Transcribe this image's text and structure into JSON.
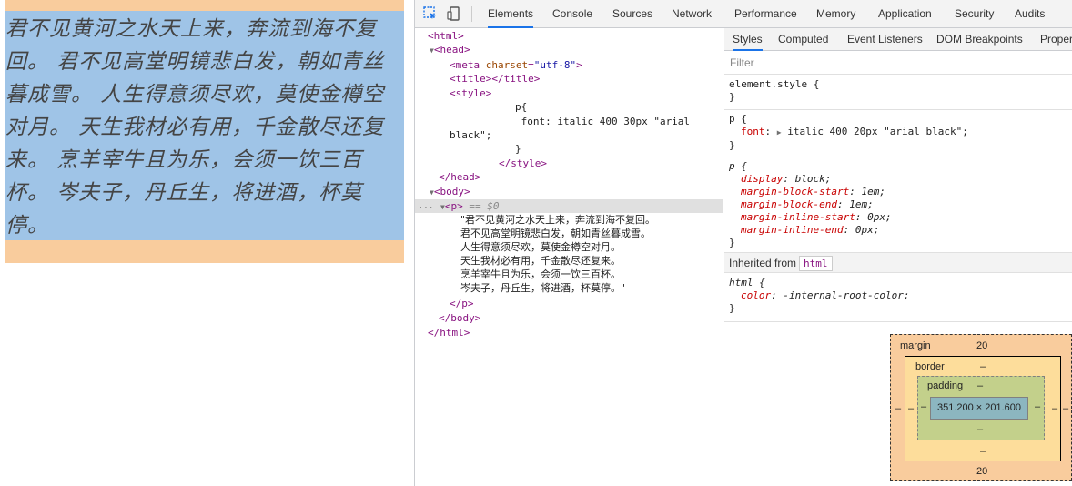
{
  "page": {
    "poem": "君不见黄河之水天上来，奔流到海不复回。 君不见高堂明镜悲白发，朝如青丝暮成雪。 人生得意须尽欢，莫使金樽空对月。 天生我材必有用，千金散尽还复来。 烹羊宰牛且为乐，会须一饮三百杯。 岑夫子，丹丘生，将进酒，杯莫停。"
  },
  "toolbar": {
    "tabs": [
      "Elements",
      "Console",
      "Sources",
      "Network",
      "Performance",
      "Memory",
      "Application",
      "Security",
      "Audits"
    ],
    "active_tab": "Elements"
  },
  "elements": {
    "html_open": "<html>",
    "head_open": "<head>",
    "meta_tag": "meta",
    "meta_attr": "charset",
    "meta_val": "\"utf-8\"",
    "title_open": "<title>",
    "title_close": "</title>",
    "style_open": "<style>",
    "css_l1": "p{",
    "css_l2": " font: italic 400 30px \"arial",
    "css_l3": "black\";",
    "css_l4": "}",
    "style_close": "</style>",
    "head_close": "</head>",
    "body_open": "<body>",
    "p_open": "<p>",
    "p_eq": "== $0",
    "p_text": [
      "\"君不见黄河之水天上来，奔流到海不复回。",
      "君不见高堂明镜悲白发，朝如青丝暮成雪。",
      "人生得意须尽欢，莫使金樽空对月。",
      "天生我材必有用，千金散尽还复来。",
      "烹羊宰牛且为乐，会须一饮三百杯。",
      "岑夫子，丹丘生，将进酒，杯莫停。\""
    ],
    "p_close": "</p>",
    "body_close": "</body>",
    "html_close": "</html>",
    "ellipsis": "..."
  },
  "styles_pane": {
    "tabs": [
      "Styles",
      "Computed",
      "Event Listeners",
      "DOM Breakpoints",
      "Proper"
    ],
    "active_tab": "Styles",
    "filter_placeholder": "Filter",
    "element_style": "element.style {",
    "close_brace": "}",
    "rule1_selector": "p {",
    "rule1_prop": "font",
    "rule1_value": "italic 400 20px \"arial black\";",
    "rule2_selector": "p {",
    "rule2_props": [
      {
        "name": "display",
        "value": "block;"
      },
      {
        "name": "margin-block-start",
        "value": "1em;"
      },
      {
        "name": "margin-block-end",
        "value": "1em;"
      },
      {
        "name": "margin-inline-start",
        "value": "0px;"
      },
      {
        "name": "margin-inline-end",
        "value": "0px;"
      }
    ],
    "inherited_label": "Inherited from",
    "inherited_tag": "html",
    "rule3_selector": "html {",
    "rule3_prop": "color",
    "rule3_value": "-internal-root-color;"
  },
  "box_model": {
    "margin_label": "margin",
    "margin_top": "20",
    "margin_bottom": "20",
    "margin_left": "–",
    "margin_right": "–",
    "border_label": "border",
    "border_top": "–",
    "border_bottom": "–",
    "border_left": "–",
    "border_right": "–",
    "padding_label": "padding",
    "padding_top": "–",
    "padding_bottom": "–",
    "padding_left": "–",
    "padding_right": "–",
    "content_size": "351.200 × 201.600"
  }
}
